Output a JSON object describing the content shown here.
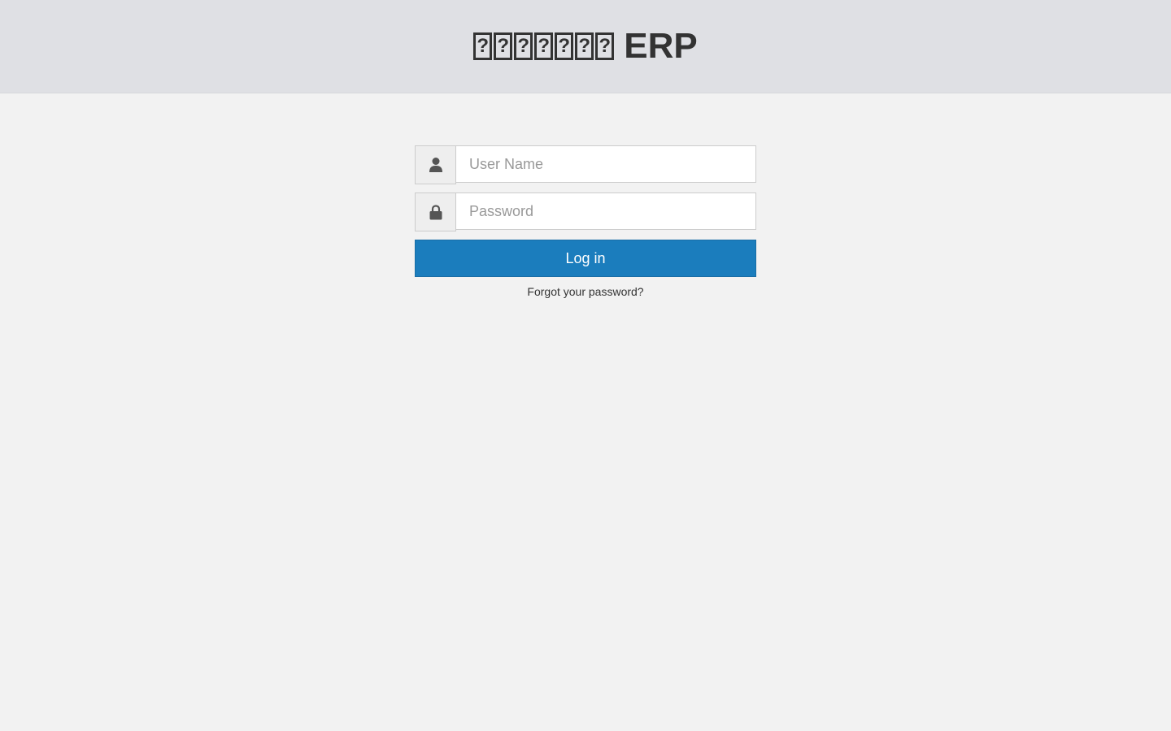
{
  "header": {
    "title_glyphs": [
      "?",
      "?",
      "?",
      "?",
      "?",
      "?",
      "?"
    ],
    "title_suffix": "ERP"
  },
  "login": {
    "username": {
      "placeholder": "User Name",
      "value": "",
      "icon": "user-icon"
    },
    "password": {
      "placeholder": "Password",
      "value": "",
      "icon": "lock-icon"
    },
    "submit_label": "Log in",
    "forgot_label": "Forgot your password?"
  },
  "colors": {
    "header_bg": "#dfe0e4",
    "page_bg": "#f2f2f2",
    "primary_button": "#1b7dbd",
    "text": "#333333"
  }
}
